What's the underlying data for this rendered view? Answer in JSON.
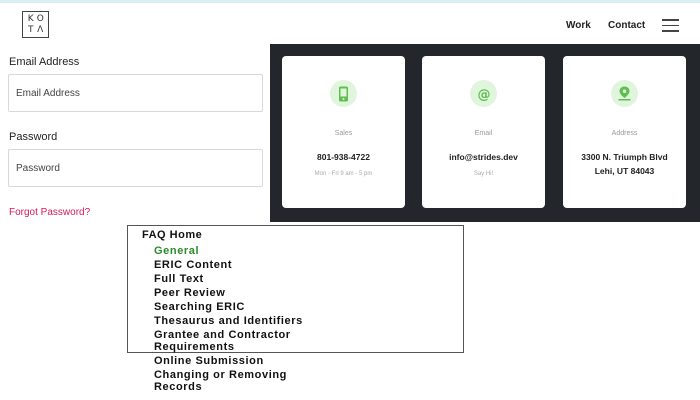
{
  "header": {
    "logo_letters": [
      "K",
      "O",
      "T",
      "Λ"
    ],
    "nav": {
      "work": "Work",
      "contact": "Contact"
    }
  },
  "login": {
    "email_label": "Email Address",
    "email_placeholder": "Email Address",
    "password_label": "Password",
    "password_placeholder": "Password",
    "forgot_link": "Forgot Password?"
  },
  "contact": {
    "cards": [
      {
        "icon": "phone-icon",
        "category": "Sales",
        "value": "801-938-4722",
        "sub": "Mon - Fri 9 am - 5 pm"
      },
      {
        "icon": "at-icon",
        "category": "Email",
        "value": "info@strides.dev",
        "sub": "Say Hi!"
      },
      {
        "icon": "map-pin-icon",
        "category": "Address",
        "value_line1": "3300 N. Triumph Blvd",
        "value_line2": "Lehi, UT 84043"
      }
    ],
    "accent_color": "#5fbe4f"
  },
  "faq": {
    "home": "FAQ Home",
    "items": [
      "General",
      "ERIC Content",
      "Full Text",
      "Peer Review",
      "Searching ERIC",
      "Thesaurus and Identifiers",
      "Grantee and Contractor",
      "Requirements",
      "Online Submission",
      "Changing or Removing",
      "Records"
    ],
    "active_color": "#2b8a2b"
  }
}
